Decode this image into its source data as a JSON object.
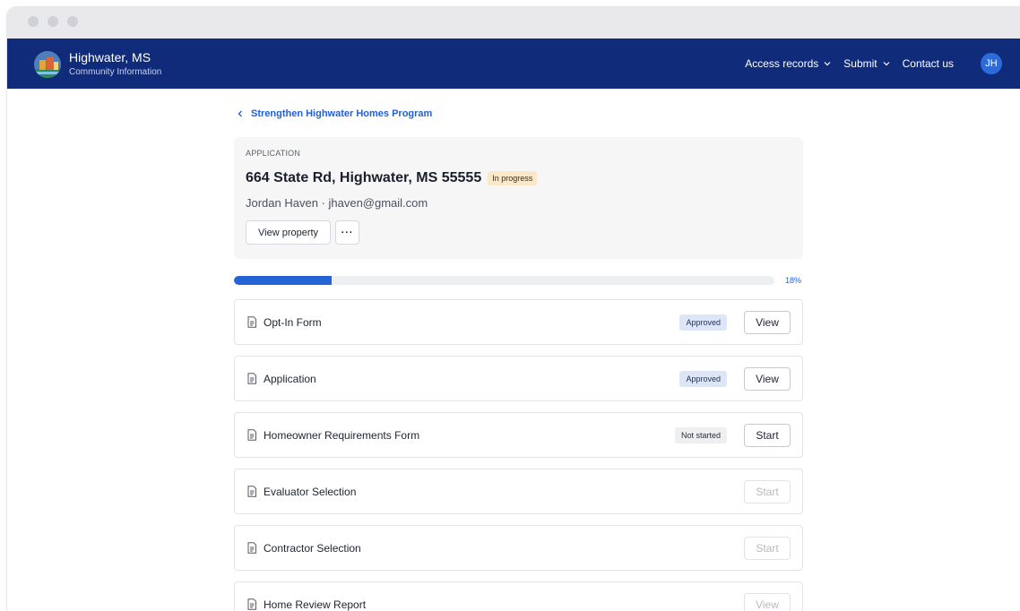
{
  "header": {
    "title": "Highwater, MS",
    "subtitle": "Community Information",
    "nav": [
      {
        "label": "Access records"
      },
      {
        "label": "Submit"
      },
      {
        "label": "Contact us"
      }
    ],
    "avatar_initials": "JH"
  },
  "breadcrumb": {
    "back_label": "Strengthen Highwater Homes Program"
  },
  "application": {
    "kicker": "APPLICATION",
    "address": "664 State Rd, Highwater, MS 55555",
    "status": "In progress",
    "person": "Jordan Haven · jhaven@gmail.com",
    "view_property_label": "View property",
    "more_label": "···"
  },
  "progress": {
    "percent": 18,
    "label": "18%"
  },
  "tasks": [
    {
      "name": "Opt-In Form",
      "status": "Approved",
      "action": "View"
    },
    {
      "name": "Application",
      "status": "Approved",
      "action": "View"
    },
    {
      "name": "Homeowner Requirements Form",
      "status": "Not started",
      "action": "Start"
    },
    {
      "name": "Evaluator Selection",
      "status": "",
      "action": "Start"
    },
    {
      "name": "Contractor Selection",
      "status": "",
      "action": "Start"
    },
    {
      "name": "Home Review Report",
      "status": "",
      "action": "View"
    }
  ],
  "colors": {
    "brand": "#0f2b7a",
    "accent": "#2664d6",
    "in_progress_badge": "#fbe8c8",
    "approved_badge": "#dde6f7"
  }
}
